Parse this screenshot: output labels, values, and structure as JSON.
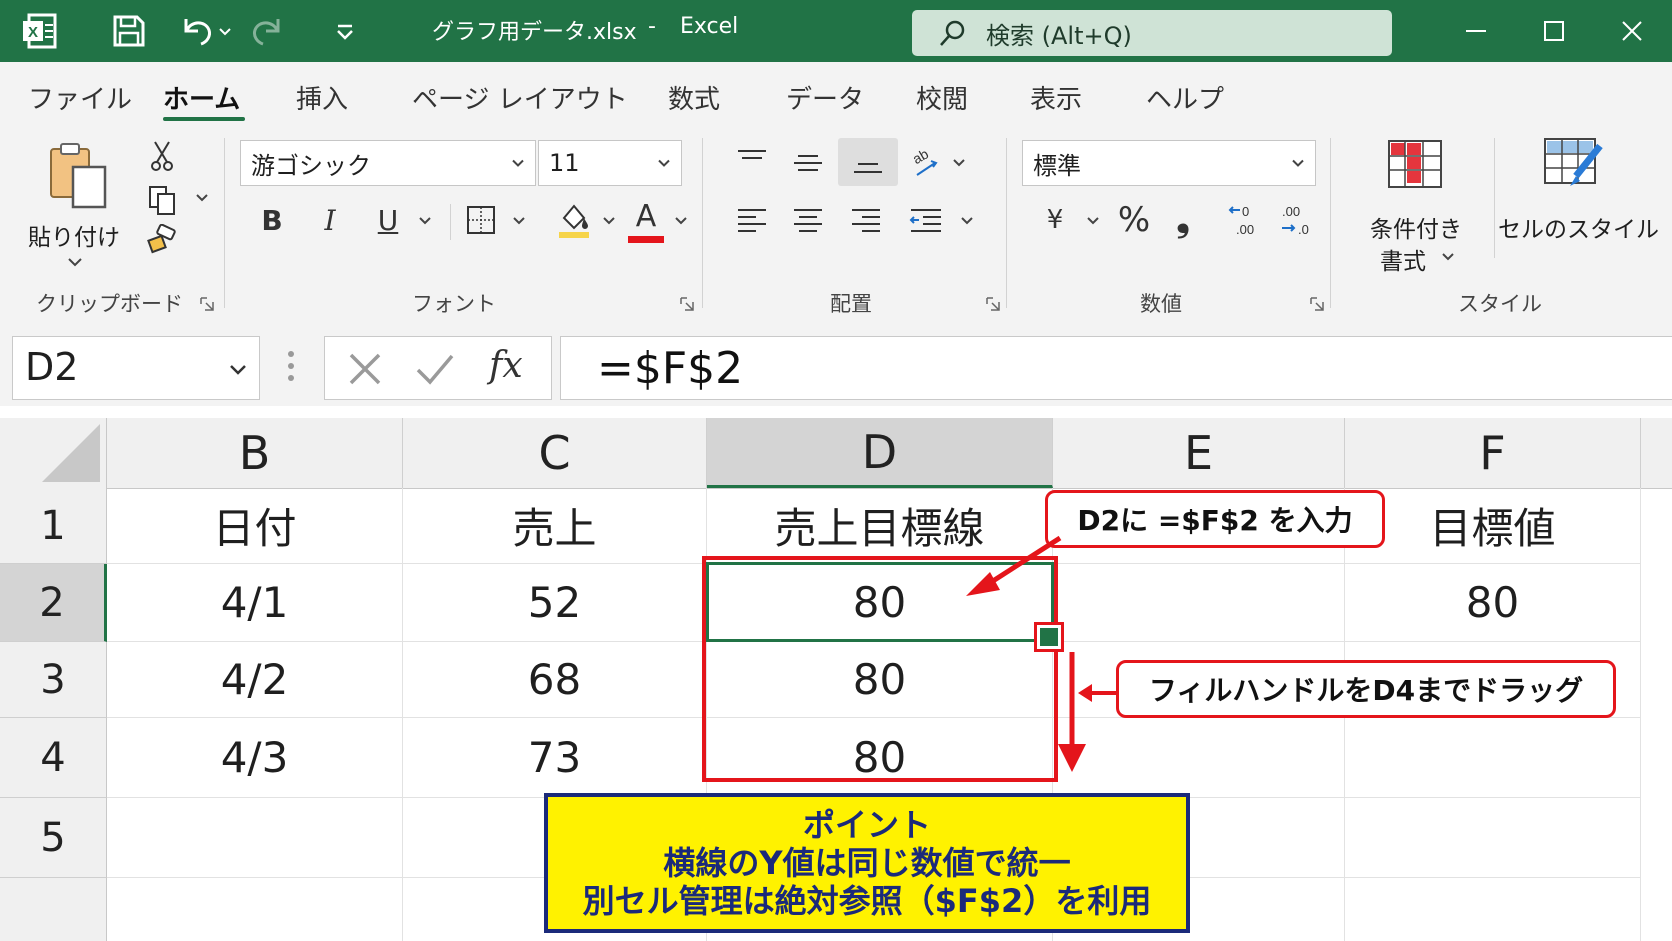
{
  "titlebar": {
    "document_title": "グラフ用データ.xlsx",
    "separator": "-",
    "app_name": "Excel",
    "search_placeholder": "検索 (Alt+Q)",
    "bg_color": "#217346",
    "icons": [
      "excel-logo-icon",
      "save-icon",
      "undo-icon",
      "redo-icon",
      "customize-qat-icon",
      "search-icon",
      "minimize-icon",
      "maximize-icon",
      "close-icon"
    ]
  },
  "ribbon_tabs": [
    "ファイル",
    "ホーム",
    "挿入",
    "ページ レイアウト",
    "数式",
    "データ",
    "校閲",
    "表示",
    "ヘルプ"
  ],
  "active_tab": "ホーム",
  "ribbon": {
    "clipboard": {
      "paste_label": "貼り付け",
      "group_label": "クリップボード"
    },
    "font": {
      "font_name": "游ゴシック",
      "font_size": "11",
      "bold": "B",
      "italic": "I",
      "underline": "U",
      "font_color_letter": "A",
      "group_label": "フォント"
    },
    "alignment": {
      "group_label": "配置"
    },
    "number": {
      "format": "標準",
      "currency": "¥",
      "percent": "%",
      "comma": "❟",
      "group_label": "数値"
    },
    "styles": {
      "conditional_line1": "条件付き",
      "conditional_line2": "書式",
      "cell_styles": "セルのスタイル",
      "group_label": "スタイル"
    }
  },
  "formula_bar": {
    "name_box": "D2",
    "formula": "=$F$2",
    "fx": "fx"
  },
  "grid": {
    "columns": [
      "B",
      "C",
      "D",
      "E",
      "F"
    ],
    "selected_column": "D",
    "rows": [
      {
        "row": "1",
        "B": "日付",
        "C": "売上",
        "D": "売上目標線",
        "E": "",
        "F": "目標値"
      },
      {
        "row": "2",
        "B": "4/1",
        "C": "52",
        "D": "80",
        "E": "",
        "F": "80"
      },
      {
        "row": "3",
        "B": "4/2",
        "C": "68",
        "D": "80",
        "E": "",
        "F": ""
      },
      {
        "row": "4",
        "B": "4/3",
        "C": "73",
        "D": "80",
        "E": "",
        "F": ""
      },
      {
        "row": "5",
        "B": "",
        "C": "",
        "D": "",
        "E": "",
        "F": ""
      }
    ],
    "active_cell": "D2"
  },
  "annotations": {
    "callout_input": "D2に =$F$2 を入力",
    "callout_drag": "フィルハンドルをD4までドラッグ",
    "point_title": "ポイント",
    "point_line1": "横線のY値は同じ数値で統一",
    "point_line2": "別セル管理は絶対参照（$F$2）を利用",
    "highlight_color": "#e4151b",
    "point_bg": "#fff200",
    "point_text_color": "#1b2a7a"
  }
}
